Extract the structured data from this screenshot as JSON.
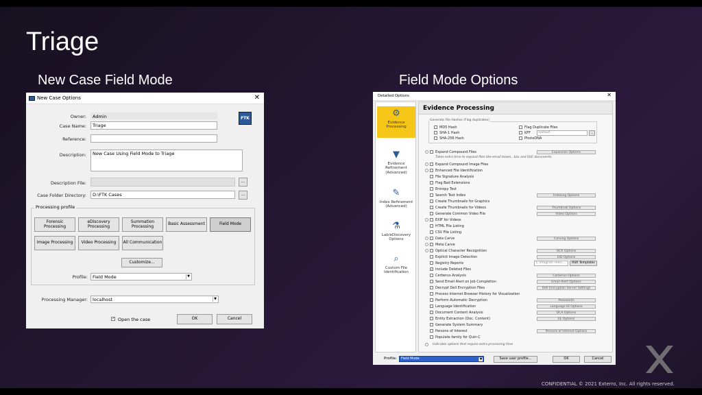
{
  "slide": {
    "title": "Triage",
    "left_heading": "New Case Field Mode",
    "right_heading": "Field Mode Options",
    "footer": "CONFIDENTIAL © 2021 Exterro, Inc. All rights reserved."
  },
  "new_case": {
    "window_title": "New Case Options",
    "close": "✕",
    "logo_text": "FTK",
    "owner_label": "Owner:",
    "owner_value": "Admin",
    "case_name_label": "Case Name:",
    "case_name_value": "Triage",
    "reference_label": "Reference:",
    "reference_value": "",
    "description_label": "Description:",
    "description_value": "New Case Using Field Mode to Triage",
    "description_file_label": "Description File:",
    "case_folder_label": "Case Folder Directory:",
    "case_folder_value": "D:\\FTK Cases",
    "browse": "...",
    "processing_profile_label": "Processing profile",
    "profiles": [
      "Forensic Processing",
      "eDiscovery Processing",
      "Summation Processing",
      "Basic Assessment",
      "Field Mode",
      "Image Processing",
      "Video Processing",
      "All Communication"
    ],
    "selected_profile": "Field Mode",
    "customize": "Customize...",
    "profile_label": "Profile:",
    "profile_value": "Field Mode",
    "processing_manager_label": "Processing Manager:",
    "processing_manager_value": "localhost",
    "open_case_label": "Open the case",
    "open_case_checked": true,
    "ok": "OK",
    "cancel": "Cancel"
  },
  "detailed": {
    "window_title": "Detailed Options",
    "close": "✕",
    "sidebar": [
      {
        "label": "Evidence Processing",
        "icon": "gears-icon",
        "active": true
      },
      {
        "label": "Evidence Refinement (Advanced)",
        "icon": "funnel-icon",
        "active": false
      },
      {
        "label": "Index Refinement (Advanced)",
        "icon": "pen-icon",
        "active": false
      },
      {
        "label": "Lab/eDiscovery Options",
        "icon": "flask-icon",
        "active": false
      },
      {
        "label": "Custom File Identification",
        "icon": "magnifier-icon",
        "active": false
      }
    ],
    "panel_title": "Evidence Processing",
    "hash_group_label": "Generate File Hashes (Flag duplicates)",
    "hashes": [
      "MD5 Hash",
      "SHA-1 Hash",
      "SHA-256 Hash"
    ],
    "hash_right": [
      "Flag Duplicate Files",
      "KFF",
      "PhotoDNA"
    ],
    "kff_value": "Default",
    "options": [
      "Expand Compound Files",
      "Expand Compound Image Files",
      "Enhanced File Identification",
      "File Signature Analysis",
      "Flag Bad Extensions",
      "Entropy Test",
      "Search Text Index",
      "Create Thumbnails for Graphics",
      "Create Thumbnails for Videos",
      "Generate Common Video File",
      "EXIF for Videos",
      "HTML File Listing",
      "CSV File Listing",
      "Data Carve",
      "Meta Carve",
      "Optical Character Recognition",
      "Explicit Image Detection",
      "Registry Reports",
      "Include Deleted Files",
      "Cerberus Analysis",
      "Send Email Alert on Job Completion",
      "Decrypt Dell Encryption Files",
      "Process Internet Browser History for Visualization",
      "Perform Automatic Decryption",
      "Language Identification",
      "Document Content Analysis",
      "Entity Extraction (Doc. Content)",
      "Generate System Summary",
      "Persons of Interest",
      "Populate family for Quin-C"
    ],
    "checked_option": "Include Deleted Files",
    "expand_note": "Takes extra time to expand files like email boxes, .bzx and OLE documents.",
    "footer_note": "Indicates options that require extra processing time",
    "option_buttons": [
      "Expansion Options",
      "Indexing Options",
      "Thumbnail Options",
      "Video Options",
      "Carving Options",
      "OCR Options",
      "EID Options",
      "Cerberus Options",
      "Email Alert Options",
      "Dell Encryption Server Settings",
      "Passwords",
      "Language ID Options",
      "DCA Options",
      "EE Options",
      "Persons of Interest Options"
    ],
    "registry_path": "C:\\Program Files\\...",
    "registry_button": "RSR Templates",
    "profile_label": "Profile:",
    "profile_value": "Field Mode",
    "save_profile": "Save user profile...",
    "ok": "OK",
    "cancel": "Cancel"
  }
}
